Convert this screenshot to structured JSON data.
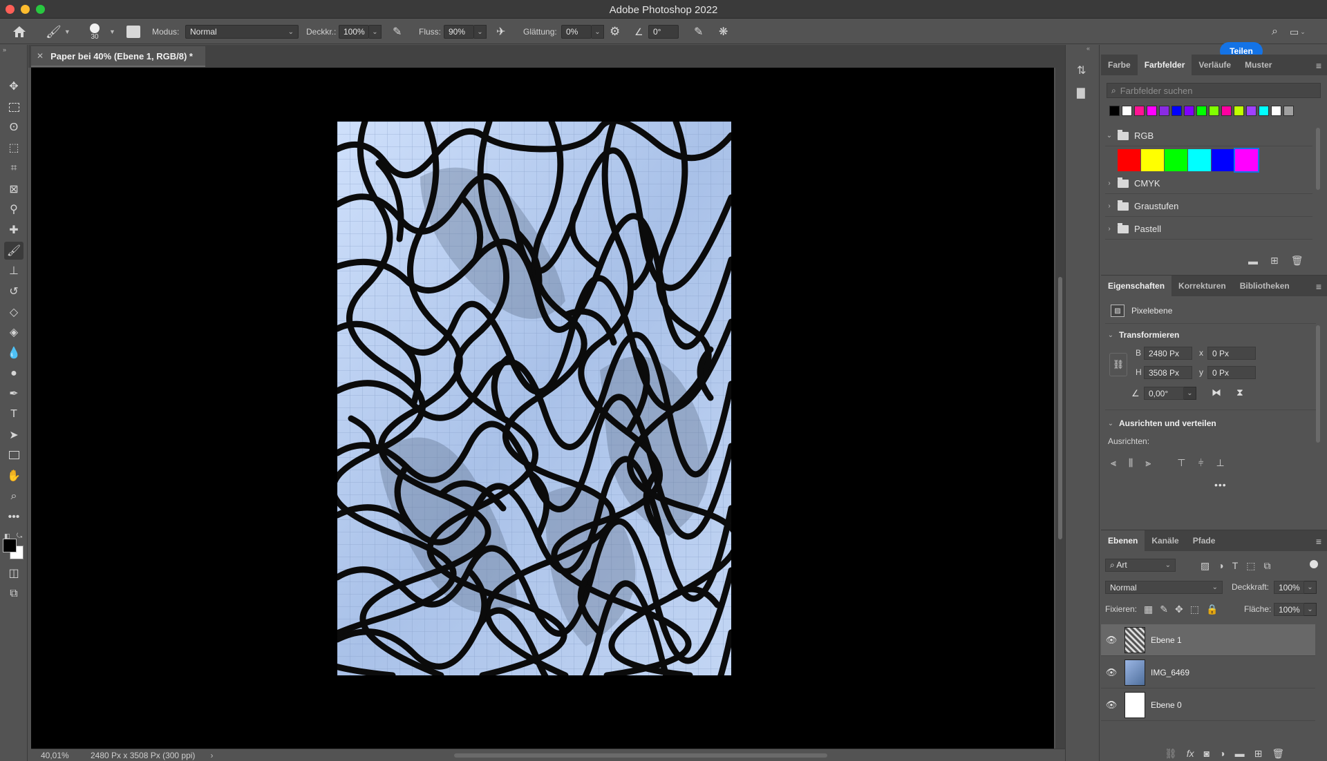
{
  "window": {
    "title": "Adobe Photoshop 2022"
  },
  "options_bar": {
    "brush_size": "30",
    "mode_label": "Modus:",
    "mode_value": "Normal",
    "opacity_label": "Deckkr.:",
    "opacity_value": "100%",
    "flow_label": "Fluss:",
    "flow_value": "90%",
    "smoothing_label": "Glättung:",
    "smoothing_value": "0%",
    "angle_value": "0°",
    "share_label": "Teilen"
  },
  "document": {
    "tab_title": "Paper bei 40% (Ebene 1, RGB/8) *",
    "zoom": "40,01%",
    "info": "2480 Px x 3508 Px (300 ppi)"
  },
  "swatches_panel": {
    "tabs": [
      "Farbe",
      "Farbfelder",
      "Verläufe",
      "Muster"
    ],
    "active_tab": "Farbfelder",
    "search_placeholder": "Farbfelder suchen",
    "recent_colors": [
      "#000000",
      "#ffffff",
      "#ff1493",
      "#ff00ff",
      "#8a2be2",
      "#0000ff",
      "#8000ff",
      "#00ff00",
      "#80ff00",
      "#ff00a0",
      "#c0ff00",
      "#a040ff",
      "#00ffff",
      "#ffffff",
      "#a0a0a0"
    ],
    "groups": [
      {
        "name": "RGB",
        "expanded": true,
        "colors": [
          "#ff0000",
          "#ffff00",
          "#00ff00",
          "#00ffff",
          "#0000ff",
          "#ff00ff"
        ]
      },
      {
        "name": "CMYK",
        "expanded": false
      },
      {
        "name": "Graustufen",
        "expanded": false
      },
      {
        "name": "Pastell",
        "expanded": false
      }
    ]
  },
  "properties_panel": {
    "tabs": [
      "Eigenschaften",
      "Korrekturen",
      "Bibliotheken"
    ],
    "active_tab": "Eigenschaften",
    "layer_type": "Pixelebene",
    "transform_title": "Transformieren",
    "w_label": "B",
    "w_value": "2480 Px",
    "h_label": "H",
    "h_value": "3508 Px",
    "x_label": "x",
    "x_value": "0 Px",
    "y_label": "y",
    "y_value": "0 Px",
    "angle_value": "0,00°",
    "align_title": "Ausrichten und verteilen",
    "align_label": "Ausrichten:"
  },
  "layers_panel": {
    "tabs": [
      "Ebenen",
      "Kanäle",
      "Pfade"
    ],
    "active_tab": "Ebenen",
    "filter_value": "Art",
    "blend_mode": "Normal",
    "opacity_label": "Deckkraft:",
    "opacity_value": "100%",
    "lock_label": "Fixieren:",
    "fill_label": "Fläche:",
    "fill_value": "100%",
    "layers": [
      {
        "name": "Ebene 1",
        "selected": true
      },
      {
        "name": "IMG_6469",
        "selected": false
      },
      {
        "name": "Ebene 0",
        "selected": false
      }
    ]
  }
}
